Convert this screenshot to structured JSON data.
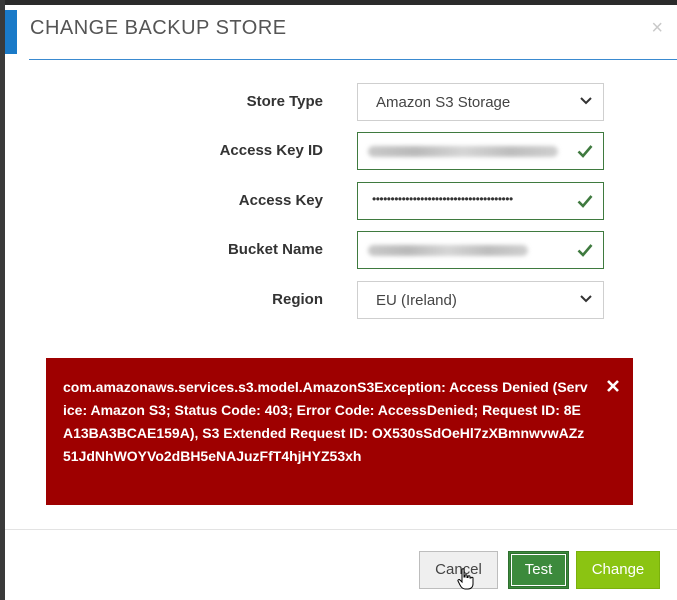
{
  "dialog": {
    "title": "CHANGE BACKUP STORE",
    "close_icon": "close-icon"
  },
  "form": {
    "store_type": {
      "label": "Store Type",
      "value": "Amazon S3 Storage"
    },
    "access_key_id": {
      "label": "Access Key ID",
      "value": ""
    },
    "access_key": {
      "label": "Access Key",
      "value": "••••••••••••••••••••••••••••••••••••••"
    },
    "bucket_name": {
      "label": "Bucket Name",
      "value": ""
    },
    "region": {
      "label": "Region",
      "value": "EU (Ireland)"
    }
  },
  "error": {
    "message": "com.amazonaws.services.s3.model.AmazonS3Exception: Access Denied (Service: Amazon S3; Status Code: 403; Error Code: AccessDenied; Request ID: 8EA13BA3BCAE159A), S3 Extended Request ID: OX530sSdOeHl7zXBmnwvwAZz51JdNhWOYVo2dBH5eNAJuzFfT4hjHYZ53xh"
  },
  "buttons": {
    "cancel": "Cancel",
    "test": "Test",
    "change": "Change"
  },
  "colors": {
    "accent": "#1a7ac8",
    "error_bg": "#9e0000",
    "valid_border": "#3f7a3f",
    "test_bg": "#3c8a3c",
    "change_bg": "#8bc412"
  }
}
